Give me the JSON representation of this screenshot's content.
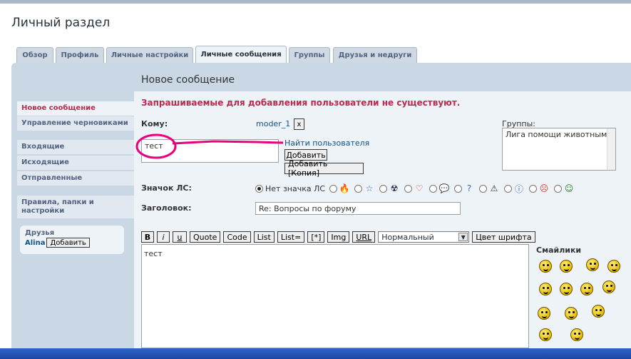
{
  "page": {
    "title": "Личный раздел",
    "heading": "Новое сообщение"
  },
  "tabs": [
    {
      "label": "Обзор"
    },
    {
      "label": "Профиль"
    },
    {
      "label": "Личные настройки"
    },
    {
      "label": "Личные сообщения"
    },
    {
      "label": "Группы"
    },
    {
      "label": "Друзья и недруги"
    }
  ],
  "sidebar": {
    "items": [
      {
        "label": "Новое сообщение"
      },
      {
        "label": "Управление черновиками"
      },
      {
        "label": "Входящие"
      },
      {
        "label": "Исходящие"
      },
      {
        "label": "Отправленные"
      },
      {
        "label": "Правила, папки и настройки"
      }
    ],
    "friends": {
      "title": "Друзья",
      "name": "Alina",
      "add_label": "Добавить"
    }
  },
  "form": {
    "error": "Запрашиваемые для добавления пользователи не существуют.",
    "to_label": "Кому:",
    "recipient": "moder_1",
    "remove_label": "x",
    "recipient_input": "тест",
    "find_user": "Найти пользователя",
    "add_label": "Добавить",
    "add_bcc_label": "Добавить [Копия]",
    "groups_label": "Группы:",
    "groups_value": "Лига помощи животным",
    "icon_label": "Значок ЛС:",
    "no_icon_label": "Нет значка ЛС",
    "subject_label": "Заголовок:",
    "subject_value": "Re: Вопросы по форуму",
    "message_text": "тест"
  },
  "toolbar": {
    "buttons": [
      "B",
      "i",
      "u",
      "Quote",
      "Code",
      "List",
      "List=",
      "[*]",
      "Img",
      "URL"
    ],
    "font_size": "Нормальный",
    "font_color_label": "Цвет шрифта"
  },
  "smilies": {
    "title": "Смайлики"
  },
  "colors": {
    "accent": "#bc2a4d",
    "link": "#105289",
    "panel": "#cad8e5",
    "content": "#eef3f7",
    "annotation": "#e8007e"
  },
  "icons": [
    "radio-icon",
    "flame-icon",
    "star-icon",
    "radiation-icon",
    "heart-icon",
    "speech-bubble-icon",
    "question-icon",
    "warning-icon",
    "info-icon",
    "smiley-red-icon",
    "smiley-green-icon"
  ]
}
